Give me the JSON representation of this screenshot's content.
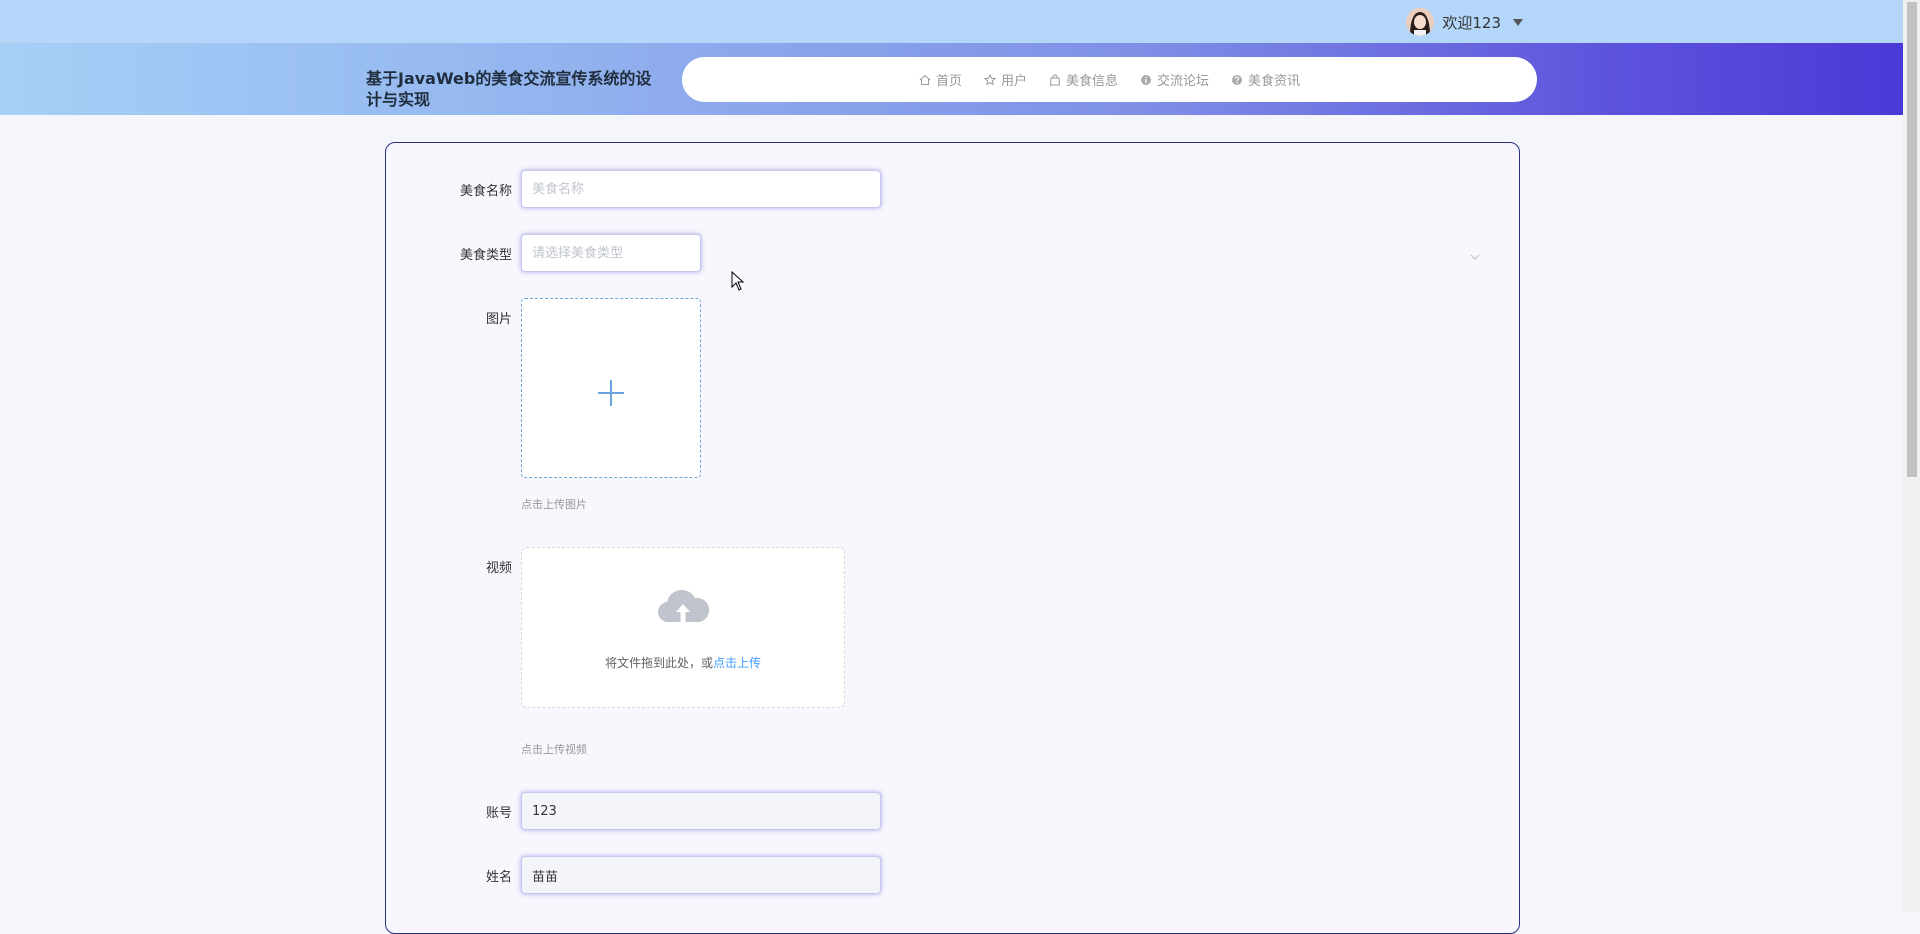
{
  "header": {
    "user_greeting": "欢迎123",
    "site_title": "基于JavaWeb的美食交流宣传系统的设计与实现"
  },
  "nav": {
    "items": [
      {
        "label": "首页",
        "icon": "home-icon"
      },
      {
        "label": "用户",
        "icon": "star-icon"
      },
      {
        "label": "美食信息",
        "icon": "bag-icon"
      },
      {
        "label": "交流论坛",
        "icon": "info-icon"
      },
      {
        "label": "美食资讯",
        "icon": "question-icon"
      }
    ]
  },
  "form": {
    "food_name": {
      "label": "美食名称",
      "placeholder": "美食名称",
      "value": ""
    },
    "food_type": {
      "label": "美食类型",
      "placeholder": "请选择美食类型",
      "value": ""
    },
    "image": {
      "label": "图片",
      "hint": "点击上传图片"
    },
    "video": {
      "label": "视频",
      "drag_text": "将文件拖到此处，或",
      "drag_link": "点击上传",
      "hint": "点击上传视频"
    },
    "account": {
      "label": "账号",
      "value": "123"
    },
    "name": {
      "label": "姓名",
      "value": "苗苗"
    }
  },
  "colors": {
    "accent": "#409eff",
    "panel_border": "#2b2f80",
    "header_gradient_start": "#a6d0f6",
    "header_gradient_end": "#4a39d6"
  }
}
